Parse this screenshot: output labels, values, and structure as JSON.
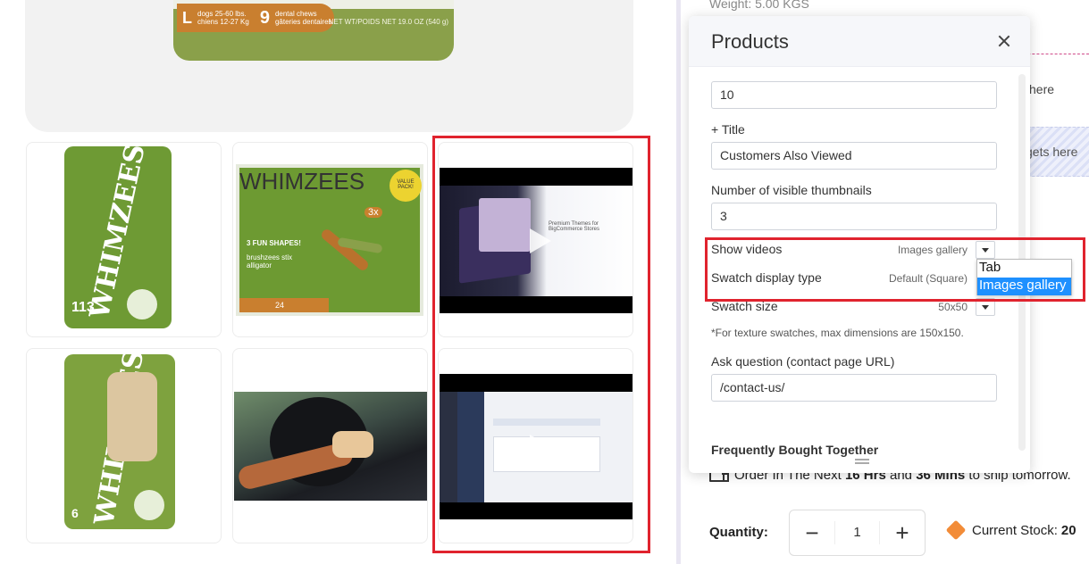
{
  "gallery": {
    "main_package": {
      "size_letter": "L",
      "size_text_line1": "dogs 25-60 lbs.",
      "size_text_line2": "chiens 12-27 Kg",
      "chew_count": "9",
      "chew_text_line1": "dental chews",
      "chew_text_line2": "gâteries dentaires",
      "net_weight": "NET WT/POIDS NET 19.0 OZ (540 g)"
    },
    "thumbnails": [
      {
        "brand": "WHIMZEES",
        "count": "113"
      },
      {
        "brand": "WHIMZEES",
        "subtitle": "3x",
        "callout": "VALUE PACK!",
        "line1": "3 FUN SHAPES!",
        "line2": "brushzees stix alligator",
        "count": "24"
      },
      {
        "type": "video",
        "caption": "Premium Themes for BigCommerce Stores"
      },
      {
        "brand": "WHIMZEES",
        "count": "6"
      },
      {
        "type": "image"
      },
      {
        "type": "video"
      }
    ]
  },
  "product_info": {
    "weight_text": "Weight: 5.00 KGS",
    "drop_here_1": "here",
    "drop_here_2": "gets here",
    "shipping_prefix": "Order In The Next ",
    "shipping_hours": "16 Hrs",
    "shipping_and": " and ",
    "shipping_mins": "36 Mins",
    "shipping_suffix": " to ship tomorrow.",
    "quantity_label": "Quantity:",
    "quantity_minus": "−",
    "quantity_value": "1",
    "quantity_plus": "+",
    "stock_label": "Current Stock:",
    "stock_value": "20"
  },
  "panel": {
    "title": "Products",
    "count_value": "10",
    "title_label": "+ Title",
    "title_value": "Customers Also Viewed",
    "visible_thumbs_label": "Number of visible thumbnails",
    "visible_thumbs_value": "3",
    "show_videos_label": "Show videos",
    "show_videos_value": "Images gallery",
    "swatch_type_label": "Swatch display type",
    "swatch_type_value": "Default (Square)",
    "swatch_size_label": "Swatch size",
    "swatch_size_value": "50x50",
    "swatch_note": "*For texture swatches, max dimensions are 150x150.",
    "ask_question_label": "Ask question (contact page URL)",
    "ask_question_value": "/contact-us/",
    "fbt_label": "Frequently Bought Together"
  },
  "dropdown": {
    "options": [
      "Tab",
      "Images gallery"
    ],
    "selected": "Images gallery"
  },
  "colors": {
    "highlight_red": "#e0232e",
    "selected_blue": "#1e90ff",
    "package_green": "#7a9a35"
  }
}
